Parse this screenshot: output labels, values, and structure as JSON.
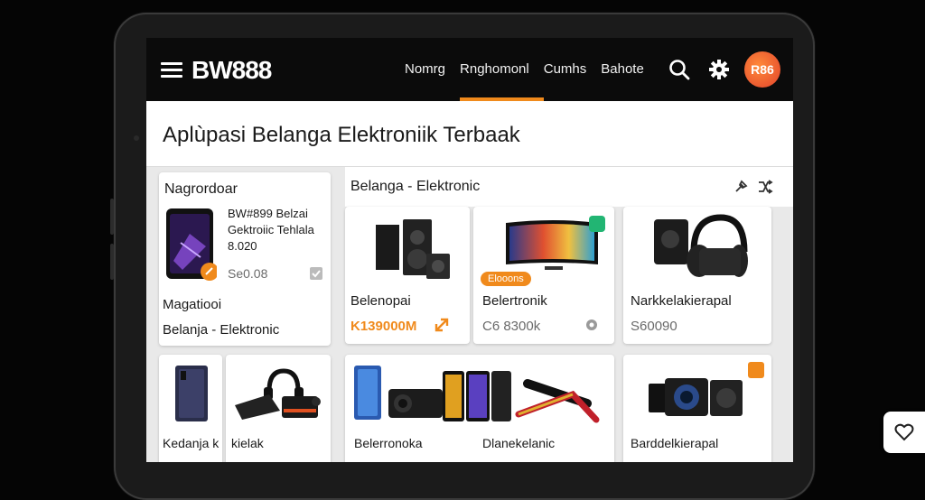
{
  "app": {
    "logo": "BW888"
  },
  "nav": {
    "items": [
      {
        "label": "Nomrg"
      },
      {
        "label": "Rnghomonl"
      },
      {
        "label": "Cumhs"
      },
      {
        "label": "Bahote"
      }
    ],
    "active_index": 1
  },
  "header": {
    "avatar_label": "R86"
  },
  "page": {
    "title": "Aplùpasi Belanga Elektroniik Terbaak"
  },
  "sidebar_card": {
    "heading": "Nagrordoar",
    "product_title_lines": [
      "BW#899 Belzai",
      "Gektroiic Tehlala",
      "8.020"
    ],
    "product_price": "Se0.08",
    "footer_label": "Magatiooi",
    "footer_subtitle": "Belanja - Elektronic"
  },
  "section": {
    "title": "Belanga - Elektronic"
  },
  "products": [
    {
      "name": "Belenopai",
      "price": "K139000M"
    },
    {
      "name": "Belertronik",
      "price": "C6 8300k",
      "badge": "Elooons"
    },
    {
      "name": "Narkkelakierapal",
      "price": "S60090"
    },
    {
      "name": "Kedanja k",
      "price": ""
    },
    {
      "name": "kielak",
      "price": ""
    },
    {
      "name": "Belerronoka",
      "price": ""
    },
    {
      "name": "Dlanekelanic",
      "price": ""
    },
    {
      "name": "Barddelkierapal",
      "price": ""
    }
  ],
  "colors": {
    "accent": "#f08a1c",
    "header_bg": "#0b0b0b",
    "badge_green": "#22b573"
  }
}
